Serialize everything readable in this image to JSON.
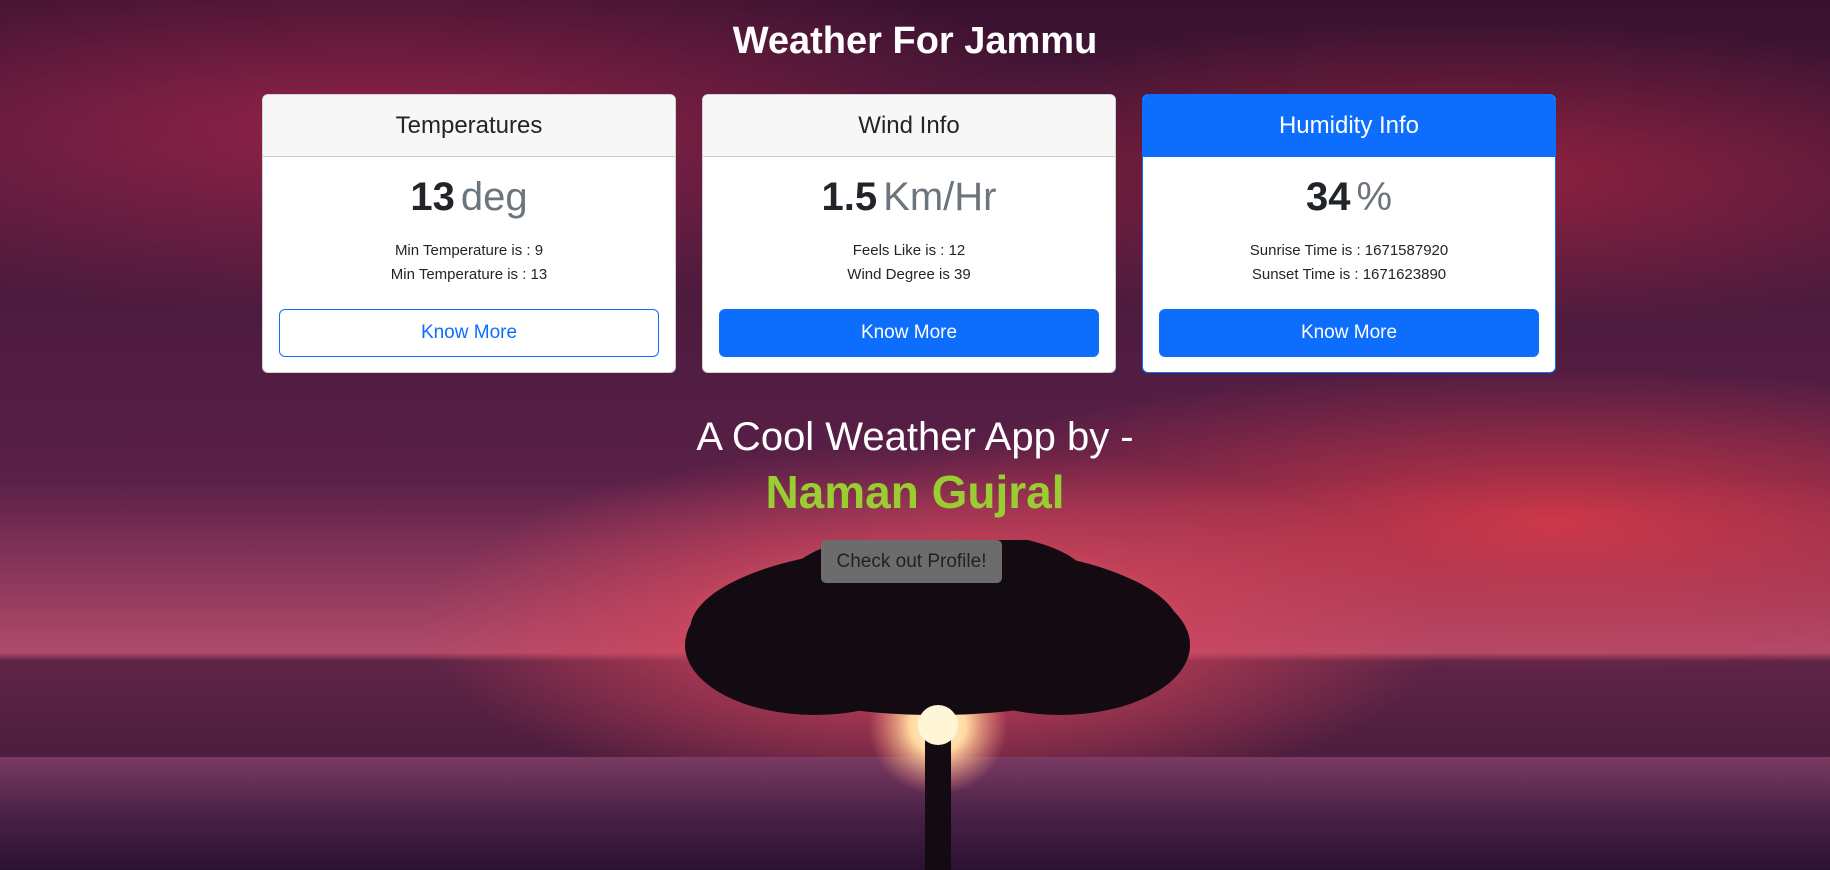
{
  "page": {
    "title": "Weather For Jammu"
  },
  "cards": [
    {
      "header": "Temperatures",
      "value": "13",
      "unit": "deg",
      "line1": "Min Temperature is : 9",
      "line2": "Min Temperature is : 13",
      "button": "Know More"
    },
    {
      "header": "Wind Info",
      "value": "1.5",
      "unit": "Km/Hr",
      "line1": "Feels Like is : 12",
      "line2": "Wind Degree is 39",
      "button": "Know More"
    },
    {
      "header": "Humidity Info",
      "value": "34",
      "unit": "%",
      "line1": "Sunrise Time is : 1671587920",
      "line2": "Sunset Time is : 1671623890",
      "button": "Know More"
    }
  ],
  "footer": {
    "tagline": "A Cool Weather App by -",
    "author": "Naman Gujral",
    "profile_button": "Check out Profile!"
  },
  "colors": {
    "primary": "#0d6efd",
    "author": "#9acd32",
    "profile_button_bg": "#6c6c6c"
  },
  "icons": [
    "tree-silhouette-background"
  ]
}
